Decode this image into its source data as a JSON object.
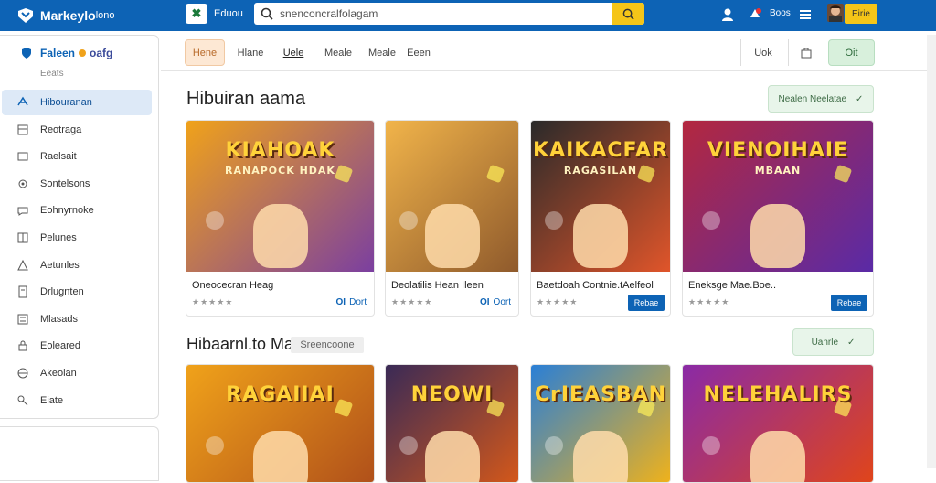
{
  "header": {
    "brand": "Markeylo",
    "brand_suffix": "lono",
    "app_chip": "✖",
    "link": "Eduou",
    "search_value": "snenconcralfolagam",
    "notify_count": "Boos",
    "user_button": "Eirie"
  },
  "sidebar": {
    "title": "Faleen",
    "title_suffix": "oafg",
    "subtitle": "Eeats",
    "items": [
      {
        "label": "Hibouranan",
        "icon": "game-icon"
      },
      {
        "label": "Reotraga",
        "icon": "box-icon"
      },
      {
        "label": "Raelsait",
        "icon": "chat-icon"
      },
      {
        "label": "Sontelsons",
        "icon": "gear-icon"
      },
      {
        "label": "Eohnyrnoke",
        "icon": "message-icon"
      },
      {
        "label": "Pelunes",
        "icon": "grid-icon"
      },
      {
        "label": "Aetunles",
        "icon": "puzzle-icon"
      },
      {
        "label": "Drlugnten",
        "icon": "doc-icon"
      },
      {
        "label": "Mlasads",
        "icon": "list-icon"
      },
      {
        "label": "Eoleared",
        "icon": "lock-icon"
      },
      {
        "label": "Akeolan",
        "icon": "globe-icon"
      },
      {
        "label": "Eiate",
        "icon": "key-icon"
      }
    ]
  },
  "tabs": [
    {
      "label": "Hene"
    },
    {
      "label": "Hlane"
    },
    {
      "label": "Uele"
    },
    {
      "label": "Meale"
    },
    {
      "label": "Meale"
    },
    {
      "label": "Eeen"
    }
  ],
  "tab_actions": {
    "right1": "Uok",
    "ok": "Oit"
  },
  "section1": {
    "title": "Hibuiran aama",
    "more": "Nealen Neelatae"
  },
  "section2": {
    "title": "Hibaarnl.to Maa",
    "chip": "Sreencoone",
    "more": "Uanrle"
  },
  "cards_row1": [
    {
      "art": "KIAHOAK",
      "art_sub": "RANAPOCK HDAK",
      "title": "Oneocecran Heag",
      "stars": "★★★★★",
      "price": "Dort",
      "price_prefix": "OI",
      "colors": [
        "#f0a21a",
        "#7b3fa0"
      ]
    },
    {
      "art": "",
      "art_sub": "",
      "title": "Deolatilis Hean Ileen",
      "stars": "★★★★★",
      "price": "Oort",
      "price_prefix": "OI",
      "colors": [
        "#f1b44a",
        "#8f5a2c"
      ]
    },
    {
      "art": "KAIKACFAR",
      "art_sub": "RAGASILAN",
      "title": "Baetdoah Contnie.tAelfeol",
      "stars": "★★★★★",
      "price": "",
      "buy": "Rebae",
      "colors": [
        "#2a2a2a",
        "#e0552a"
      ]
    },
    {
      "art": "VIENOIHAIE",
      "art_sub": "MBAAN",
      "title": "Eneksge Mae.Boe..",
      "stars": "★★★★★",
      "price": "",
      "buy": "Rebae",
      "colors": [
        "#b3283f",
        "#5a2aa6"
      ]
    }
  ],
  "cards_row2": [
    {
      "art": "RAGAIIAI",
      "colors": [
        "#f0a21a",
        "#b0501a"
      ]
    },
    {
      "art": "NEOWI",
      "colors": [
        "#3a2a56",
        "#d4581a"
      ]
    },
    {
      "art": "CrIEASBAN",
      "colors": [
        "#2a7fd6",
        "#f0b21a"
      ]
    },
    {
      "art": "NELEHALIRS",
      "colors": [
        "#8a2aa6",
        "#e0451a"
      ]
    }
  ]
}
